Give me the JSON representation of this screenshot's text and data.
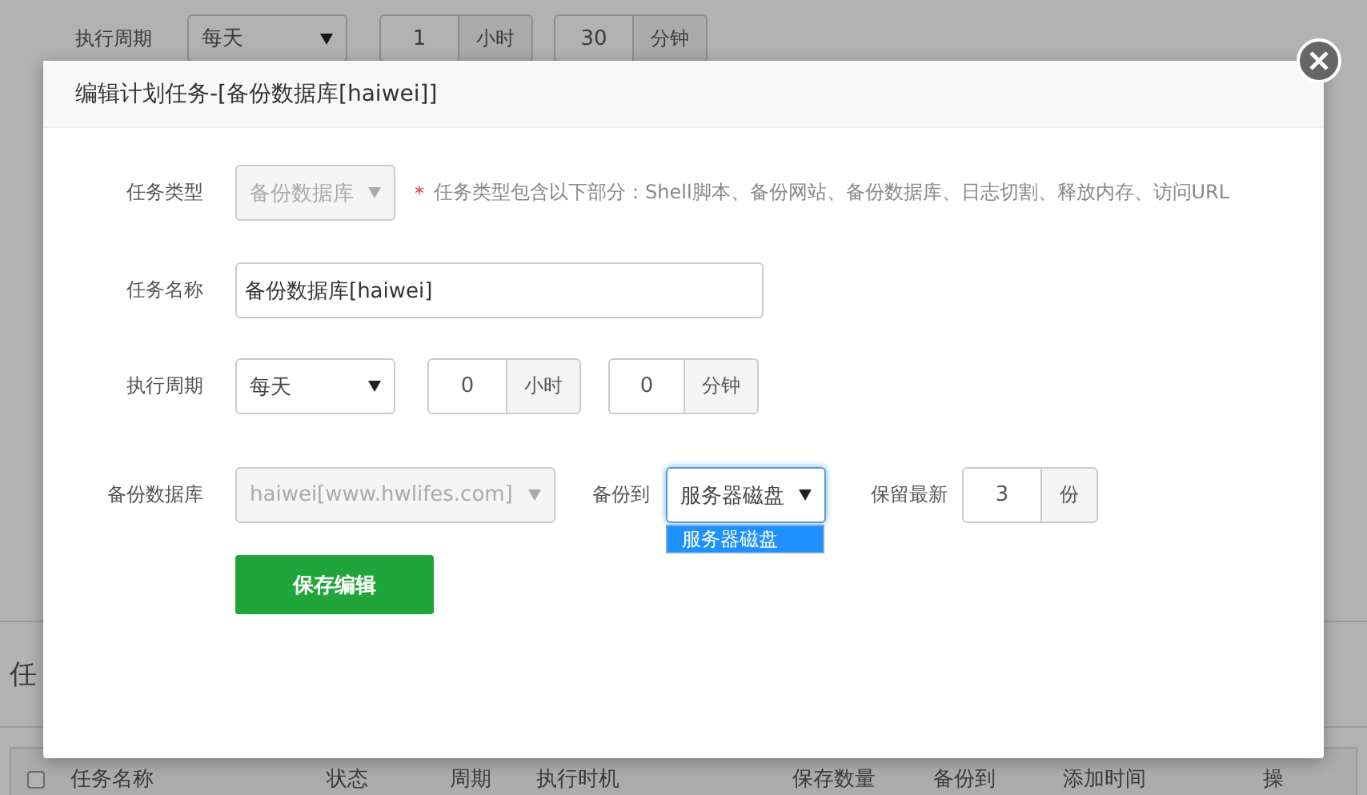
{
  "background": {
    "period_label": "执行周期",
    "period_select": "每天",
    "hour_value": "1",
    "hour_unit": "小时",
    "minute_value": "30",
    "minute_unit": "分钟",
    "section_title": "任",
    "table_columns": [
      "任务名称",
      "状态",
      "周期",
      "执行时机",
      "保存数量",
      "备份到",
      "添加时间",
      "操"
    ],
    "select_all_checked": false
  },
  "dialog": {
    "title": "编辑计划任务-[备份数据库[haiwei]]",
    "task_type": {
      "label": "任务类型",
      "value": "备份数据库",
      "disabled": true,
      "required_mark": "*",
      "hint": "任务类型包含以下部分：Shell脚本、备份网站、备份数据库、日志切割、释放内存、访问URL"
    },
    "task_name": {
      "label": "任务名称",
      "value": "备份数据库[haiwei]"
    },
    "period": {
      "label": "执行周期",
      "select": "每天",
      "hour_value": "0",
      "hour_unit": "小时",
      "minute_value": "0",
      "minute_unit": "分钟"
    },
    "database": {
      "label": "备份数据库",
      "value": "haiwei[www.hwlifes.com]",
      "disabled": true
    },
    "backup_to": {
      "label": "备份到",
      "value": "服务器磁盘",
      "expanded": true,
      "options": [
        {
          "label": "服务器磁盘",
          "selected": true
        }
      ]
    },
    "keep": {
      "label": "保留最新",
      "value": "3",
      "unit": "份"
    },
    "save_button": "保存编辑"
  }
}
